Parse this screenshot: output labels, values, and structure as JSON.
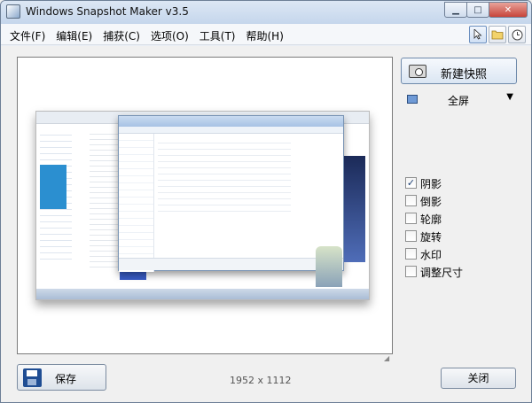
{
  "window": {
    "title": "Windows Snapshot Maker v3.5",
    "controls": {
      "minimize": "▁",
      "maximize": "□",
      "close": "✕"
    }
  },
  "menu": {
    "items": [
      "文件(F)",
      "编辑(E)",
      "捕获(C)",
      "选项(O)",
      "工具(T)",
      "帮助(H)"
    ]
  },
  "toolbar": {
    "icons": [
      "cursor-icon",
      "folder-icon",
      "clock-icon"
    ]
  },
  "panel": {
    "new_snapshot_label": "新建快照",
    "mode_label": "全屏",
    "options": [
      {
        "label": "阴影",
        "checked": true
      },
      {
        "label": "倒影",
        "checked": false
      },
      {
        "label": "轮廓",
        "checked": false
      },
      {
        "label": "旋转",
        "checked": false
      },
      {
        "label": "水印",
        "checked": false
      },
      {
        "label": "调整尺寸",
        "checked": false
      }
    ]
  },
  "footer": {
    "save_label": "保存",
    "dimensions": "1952 x 1112",
    "close_label": "关闭"
  }
}
